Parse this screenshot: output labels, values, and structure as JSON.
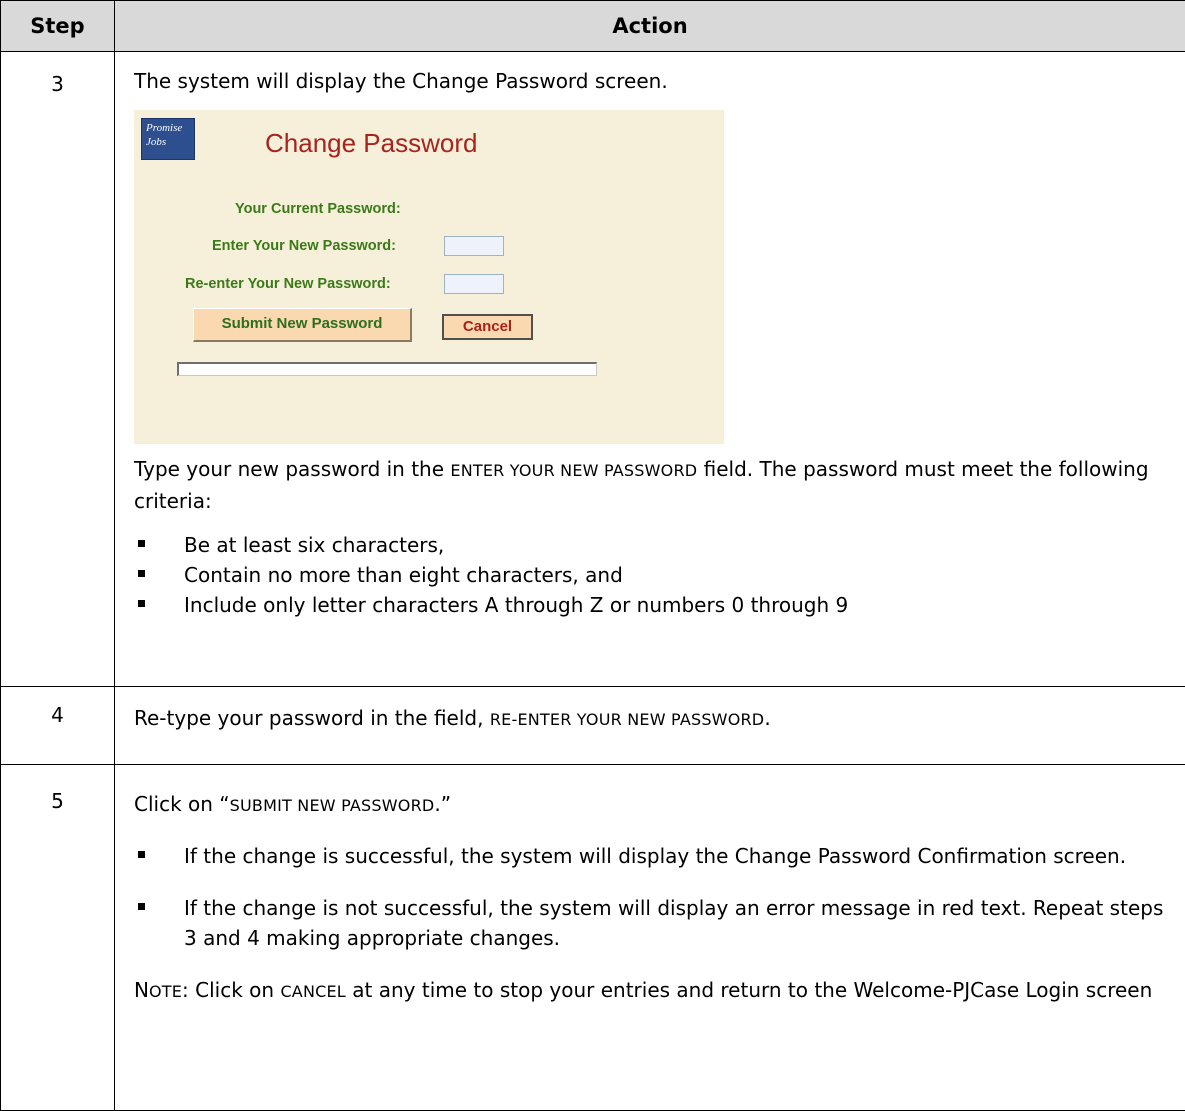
{
  "header": {
    "step": "Step",
    "action": "Action"
  },
  "rows": [
    {
      "step": "3",
      "intro": "The system will display the Change Password screen.",
      "screenshot": {
        "logo_text_1": "Promise",
        "logo_text_2": "Jobs",
        "title": "Change Password",
        "current_label": "Your Current Password:",
        "new_label": "Enter Your New Password:",
        "reenter_label": "Re-enter Your New Password:",
        "submit_label": "Submit New Password",
        "cancel_label": "Cancel"
      },
      "p1": "Type your new password in the",
      "p2": "ENTER YOUR NEW PASSWORD",
      "p3": "field. The password must meet the following criteria:",
      "criteria": [
        "Be at least six characters,",
        "Contain no more than eight characters, and",
        "Include only letter characters A through Z or numbers 0 through 9"
      ]
    },
    {
      "step": "4",
      "p1": "Re-type your password in the field,",
      "p2": "RE-ENTER YOUR NEW PASSWORD",
      "p3": "."
    },
    {
      "step": "5",
      "p1": "Click on “",
      "p2": "SUBMIT NEW PASSWORD",
      "p3": ".”",
      "bullets": [
        "If the change is successful, the system will display the Change Password Confirmation screen.",
        "If the change is not successful, the system will display an error message in red text. Repeat steps 3 and 4 making appropriate changes."
      ],
      "note_n": "N",
      "note_ote": "OTE",
      "note_mid": ": Click on",
      "note_cancel": "CANCEL",
      "note_rest": "at any time to stop your entries and return to the Welcome-PJCase Login screen"
    }
  ]
}
